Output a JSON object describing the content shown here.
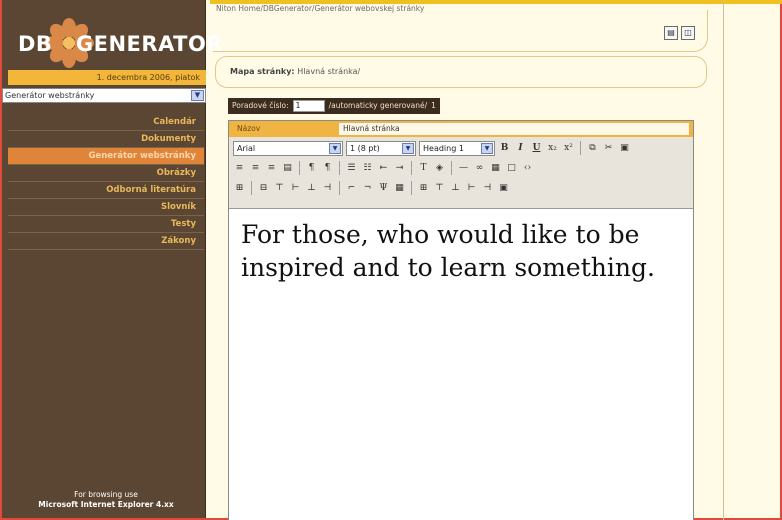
{
  "app": {
    "logo_left": "DB",
    "logo_right": "GENERATOR",
    "date": "1. decembra 2006, piatok",
    "section_select": "Generátor webstránky"
  },
  "menu": [
    {
      "label": "Calendár",
      "active": false
    },
    {
      "label": "Dokumenty",
      "active": false
    },
    {
      "label": "Generátor webstránky",
      "active": true
    },
    {
      "label": "Obrázky",
      "active": false
    },
    {
      "label": "Odborná literatúra",
      "active": false
    },
    {
      "label": "Slovník",
      "active": false
    },
    {
      "label": "Testy",
      "active": false
    },
    {
      "label": "Zákony",
      "active": false
    }
  ],
  "browse_note": {
    "line1": "For browsing use",
    "line2": "Microsoft Internet Explorer 4.xx"
  },
  "breadcrumb": "Niton Home/DBGenerator/Generátor webovskej stránky",
  "sitemap": {
    "label": "Mapa stránky:",
    "value": "Hlavná stránka/"
  },
  "order": {
    "label": "Poradové číslo:",
    "value": "1",
    "suffix": "/automaticky generované/",
    "auto_value": "1"
  },
  "editor": {
    "title_label": "Názov",
    "title_value": "Hlavná stránka",
    "font": "Arial",
    "size": "1 (8 pt)",
    "format": "Heading 1",
    "content": "For those, who would like to be inspired and to learn something."
  },
  "icons": {
    "save": "save-icon",
    "preview": "preview-icon"
  }
}
